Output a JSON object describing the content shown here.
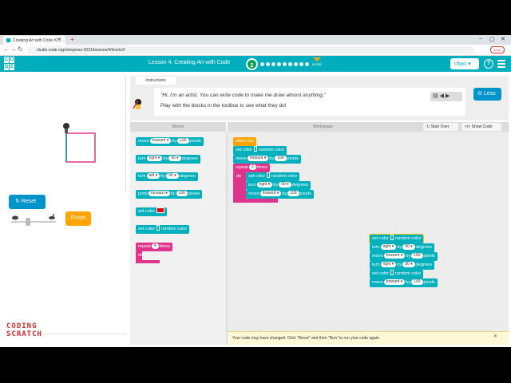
{
  "browser": {
    "tab_title": "Creating Art with Code #2 | ...",
    "url": "studio.code.org/s/express-2021/lessons/4/levels/2",
    "error_label": "Error"
  },
  "header": {
    "logo_letters": [
      "C",
      "O",
      "D",
      "E"
    ],
    "lesson_title": "Lesson 4: Creating Art with Code",
    "current_level": "2",
    "more_label": "MORE",
    "user_name": "chan",
    "help_glyph": "?"
  },
  "visualization": {
    "reset_label": "Reset",
    "finish_label": "Finish"
  },
  "instructions": {
    "tab_label": "Instructions",
    "quote": "\"Hi, I'm an artist. You can write code to make me draw almost anything.\"",
    "line": "Play with the blocks in the toolbox to see what they do!",
    "less_label": "Less"
  },
  "workspace": {
    "blocks_label": "Blocks",
    "workspace_label": "Workspace",
    "start_over_label": "Start Over",
    "show_code_label": "Show Code",
    "notice": "Your code may have changed. Click \"Reset\" and then \"Run\" to run your code again."
  },
  "toolbox": {
    "move": {
      "a": "move",
      "dir": "forward",
      "by": "by",
      "num": "100",
      "unit": "pixels"
    },
    "turn_right": {
      "a": "turn",
      "dir": "right",
      "by": "by",
      "num": "90",
      "unit": "degrees"
    },
    "turn_left": {
      "a": "turn",
      "dir": "left",
      "by": "by",
      "num": "90",
      "unit": "degrees"
    },
    "jump": {
      "a": "jump",
      "dir": "forward",
      "by": "by",
      "num": "100",
      "unit": "pixels"
    },
    "set_color": {
      "a": "set color"
    },
    "set_random": {
      "a": "set color",
      "b": "random color"
    },
    "repeat": {
      "a": "repeat",
      "num": "4",
      "b": "times",
      "do": "do"
    }
  },
  "program": {
    "when_run": "when run",
    "set_random": {
      "a": "set color",
      "b": "random color"
    },
    "move": {
      "a": "move",
      "dir": "forward",
      "by": "by",
      "num": "100",
      "unit": "pixels"
    },
    "repeat": {
      "a": "repeat",
      "num": "3",
      "b": "times",
      "do": "do"
    },
    "turn_right": {
      "a": "turn",
      "dir": "right",
      "by": "by",
      "num": "90",
      "unit": "degrees"
    }
  },
  "watermark": {
    "line1": "CODING",
    "line2": "SCRATCH"
  },
  "colors": {
    "brand": "#00adbc",
    "motion_block": "#00b0bd",
    "loop_block": "#e0348c",
    "event_block": "#ffa400",
    "drawn_line_pink": "#e0348c",
    "drawn_line_teal": "#0a8f9b"
  }
}
